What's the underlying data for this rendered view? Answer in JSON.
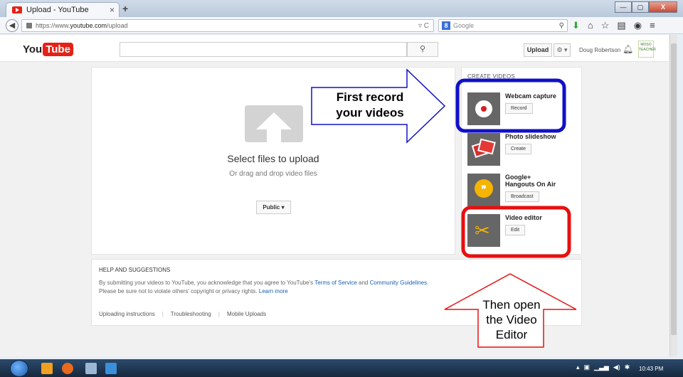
{
  "browser": {
    "tab_title": "Upload - YouTube",
    "new_tab": "+",
    "url_prefix": "https://www.",
    "url_domain": "youtube.com",
    "url_path": "/upload",
    "search_engine_placeholder": "Google",
    "min_label": "—",
    "max_label": "▢",
    "close_label": "X"
  },
  "youtube": {
    "logo_you": "You",
    "logo_tube": "Tube",
    "guide": "≡ ·",
    "search_icon": "🔍",
    "upload_label": "Upload",
    "settings_label": "⚙ ▾",
    "username": "Doug Robertson",
    "avatar_text": "MOSO TEACHER"
  },
  "upload": {
    "select_files": "Select files to upload",
    "drag_drop": "Or drag and drop video files",
    "privacy_label": "Public ▾"
  },
  "create": {
    "title": "CREATE VIDEOS",
    "items": [
      {
        "title": "Webcam capture",
        "button": "Record"
      },
      {
        "title": "Photo slideshow",
        "button": "Create"
      },
      {
        "title": "Google+ Hangouts On Air",
        "button": "Broadcast"
      },
      {
        "title": "Video editor",
        "button": "Edit"
      }
    ]
  },
  "help": {
    "title": "HELP AND SUGGESTIONS",
    "line1_pre": "By submitting your videos to YouTube, you acknowledge that you agree to YouTube's ",
    "tos": "Terms of Service",
    "and": " and ",
    "guidelines": "Community Guidelines",
    "line1_post": ".",
    "line2_pre": "Please be sure not to violate others' copyright or privacy rights. ",
    "learn_more": "Learn more",
    "links": [
      "Uploading instructions",
      "Troubleshooting",
      "Mobile Uploads"
    ]
  },
  "annotations": {
    "first_line1": "First record",
    "first_line2": "your videos",
    "then_line1": "Then open",
    "then_line2": "the Video",
    "then_line3": "Editor"
  },
  "taskbar": {
    "clock": "10:43 PM"
  },
  "colors": {
    "youtube_red": "#e62117",
    "annotation_blue": "#1010c8",
    "annotation_red": "#e61010",
    "link_blue": "#1a5fb4"
  }
}
